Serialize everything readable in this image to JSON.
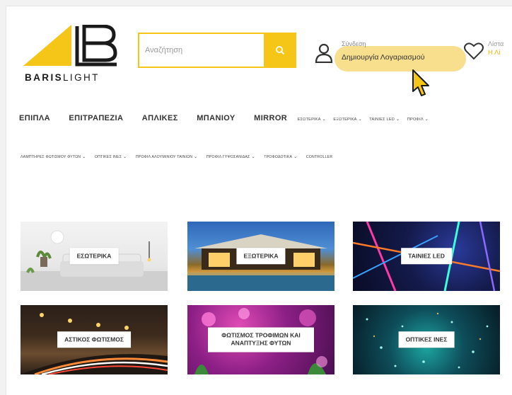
{
  "header": {
    "logo_text_bold": "BARIS",
    "logo_text_light": "LIGHT",
    "search": {
      "placeholder": "Αναζήτηση"
    },
    "account": {
      "small_label": "Σύνδεση",
      "create_account": "Δημιουργία Λογαριασμού"
    },
    "wishlist": {
      "small_label": "Λίστα",
      "count_label": "Η Λί"
    }
  },
  "nav": {
    "main_items": [
      "ΕΠΙΠΛΑ",
      "ΕΠΙΤΡΑΠΕΖΙΑ",
      "ΑΠΛΙΚΕΣ",
      "ΜΠΑΝΙΟΥ",
      "MIRROR"
    ],
    "dropdowns": [
      "ΕΣΩΤΕΡΙΚΑ",
      "ΕΞΩΤΕΡΙΚΑ",
      "ΤΑΙΝΙΕΣ LED",
      "ΠΡΟΦΙΛ"
    ],
    "secondary": [
      "ΛΑΜΠΤΗΡΕΣ ΦΩΤΙΣΜΟΥ ΦΥΤΩΝ",
      "ΟΠΤΙΚΕΣ ΙΝΕΣ",
      "ΠΡΟΦΙΛ ΑΛΟΥΜΙΝΙΟΥ ΤΑΙΝΙΩΝ",
      "ΠΡΟΦΙΛ ΓΥΨΟΣΑΝΙΔΑΣ",
      "ΤΡΟΦΟΔΟΤΙΚΑ",
      "CONTROLLER"
    ]
  },
  "tiles": [
    {
      "label": "ΕΣΩΤΕΡΙΚΑ"
    },
    {
      "label": "ΕΞΩΤΕΡΙΚΑ"
    },
    {
      "label": "ΤΑΙΝΙΕΣ LED"
    },
    {
      "label": "ΑΣΤΙΚΟΣ ΦΩΤΙΣΜΟΣ"
    },
    {
      "label": "ΦΩΤΙΣΜΟΣ ΤΡΟΦΙΜΩΝ ΚΑΙ ΑΝΑΠΤΥΞΗΣ ΦΥΤΩΝ"
    },
    {
      "label": "ΟΠΤΙΚΕΣ ΙΝΕΣ"
    }
  ],
  "colors": {
    "accent": "#f5c518",
    "highlight": "#f6d97a"
  },
  "icons": [
    "search-icon",
    "user-icon",
    "heart-icon",
    "cursor-pointer-icon",
    "chevron-down-icon"
  ]
}
